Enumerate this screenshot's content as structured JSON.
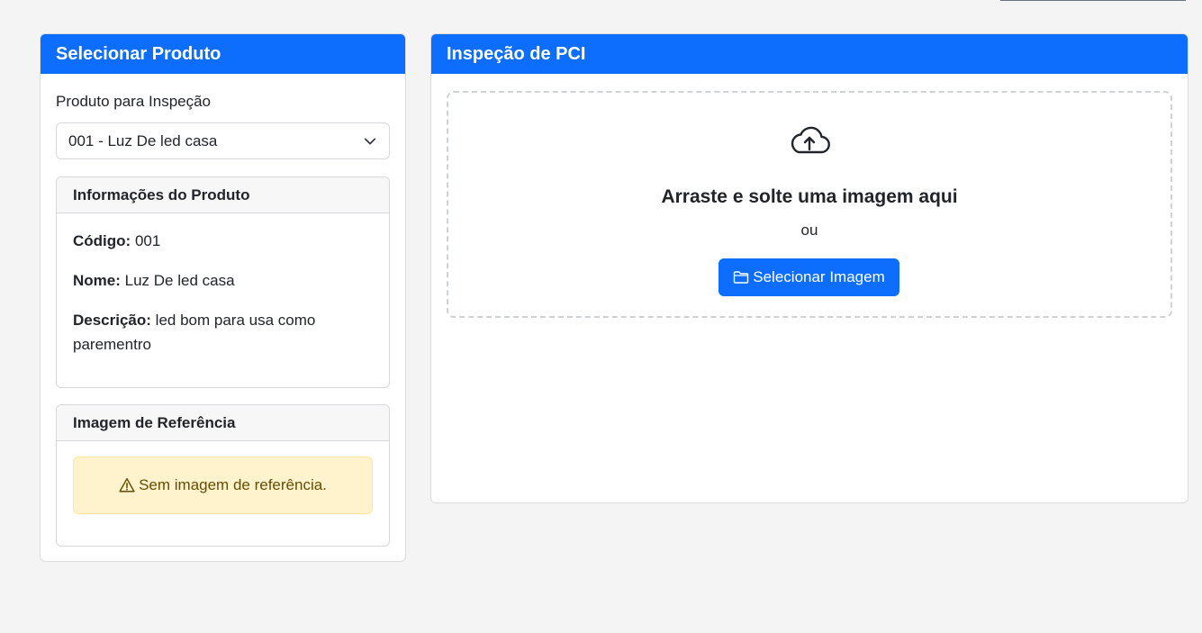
{
  "left_panel": {
    "title": "Selecionar Produto",
    "field_label": "Produto para Inspeção",
    "selected_product": "001 - Luz De led casa",
    "info_card": {
      "title": "Informações do Produto",
      "code_label": "Código:",
      "code_value": "001",
      "name_label": "Nome:",
      "name_value": "Luz De led casa",
      "description_label": "Descrição:",
      "description_value": "led bom para usa como parementro"
    },
    "reference_card": {
      "title": "Imagem de Referência",
      "warning_text": "Sem imagem de referência."
    }
  },
  "right_panel": {
    "title": "Inspeção de PCI",
    "dropzone_title": "Arraste e solte uma imagem aqui",
    "dropzone_or": "ou",
    "select_button_label": "Selecionar Imagem"
  },
  "icons": {
    "upload": "cloud-upload-icon",
    "warning": "warning-triangle-icon",
    "folder": "folder-icon",
    "chevron": "chevron-down-icon"
  },
  "colors": {
    "primary": "#0d6efd",
    "warning_bg": "#fff3cd",
    "warning_text": "#664d03",
    "page_bg": "#f4f4f4"
  }
}
